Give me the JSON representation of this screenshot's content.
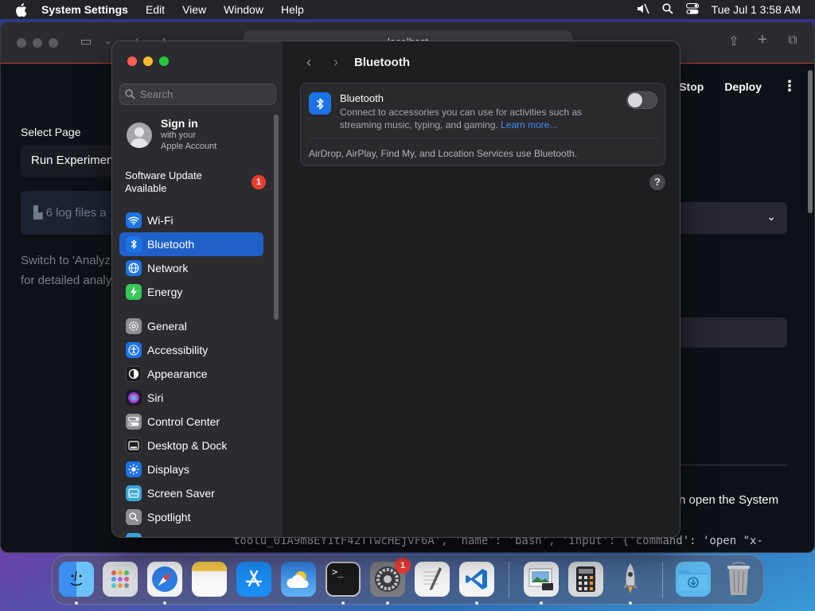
{
  "menubar": {
    "app_name": "System Settings",
    "items": [
      "Edit",
      "View",
      "Window",
      "Help"
    ],
    "datetime": "Tue Jul 1  3:58 AM"
  },
  "browser": {
    "url": "localhost",
    "header_actions": [
      "Stop",
      "Deploy"
    ],
    "select_page_label": "Select Page",
    "select_page_value": "Run Experimen",
    "info_text": "6 log files a",
    "hint_line1": "Switch to 'Analyz",
    "hint_line2": "for detailed analy",
    "right_text": "n open the System",
    "bottom_text": "toolu_01A9m8EY1tF42TTwcHEjvF6A', 'name': 'bash', 'input': {'command': 'open \"x-"
  },
  "settings": {
    "search_placeholder": "Search",
    "account": {
      "title": "Sign in",
      "line1": "with your",
      "line2": "Apple Account"
    },
    "update": {
      "line1": "Software Update",
      "line2": "Available",
      "badge": "1"
    },
    "sidebar_items": [
      {
        "label": "Wi-Fi",
        "icon": "wifi-icon",
        "color": "#1c73e8"
      },
      {
        "label": "Bluetooth",
        "icon": "bluetooth-icon",
        "color": "#1c73e8"
      },
      {
        "label": "Network",
        "icon": "globe-icon",
        "color": "#1c73e8"
      },
      {
        "label": "Energy",
        "icon": "bolt-icon",
        "color": "#34c759"
      },
      {
        "label": "General",
        "icon": "gear-icon",
        "color": "#8e8e93"
      },
      {
        "label": "Accessibility",
        "icon": "accessibility-icon",
        "color": "#1c73e8"
      },
      {
        "label": "Appearance",
        "icon": "appearance-icon",
        "color": "#1c1c1e"
      },
      {
        "label": "Siri",
        "icon": "siri-icon",
        "color": "#1c1c1e"
      },
      {
        "label": "Control Center",
        "icon": "control-center-icon",
        "color": "#8e8e93"
      },
      {
        "label": "Desktop & Dock",
        "icon": "desktop-dock-icon",
        "color": "#1c1c1e"
      },
      {
        "label": "Displays",
        "icon": "sun-icon",
        "color": "#1c73e8"
      },
      {
        "label": "Screen Saver",
        "icon": "screen-saver-icon",
        "color": "#3aa6d8"
      },
      {
        "label": "Spotlight",
        "icon": "spotlight-icon",
        "color": "#8e8e93"
      }
    ],
    "content": {
      "title": "Bluetooth",
      "bt_title": "Bluetooth",
      "bt_desc_line1": "Connect to accessories you can use for activities such as",
      "bt_desc_line2": "streaming music, typing, and gaming.",
      "learn_more": "Learn more...",
      "bt_footer": "AirDrop, AirPlay, Find My, and Location Services use Bluetooth.",
      "help": "?"
    }
  },
  "dock": {
    "apps": [
      "Finder",
      "Launchpad",
      "Safari",
      "Notes",
      "App Store",
      "Weather",
      "Terminal",
      "System Settings",
      "TextEdit",
      "Visual Studio Code",
      "Preview",
      "Calculator",
      "Rocket",
      "Downloads",
      "Trash"
    ],
    "settings_badge": "1",
    "colors": {
      "finder": "#3b8ff0",
      "safari": "#2f7de1",
      "vscode": "#1f74c6",
      "trash": "#c9cbd0"
    }
  }
}
